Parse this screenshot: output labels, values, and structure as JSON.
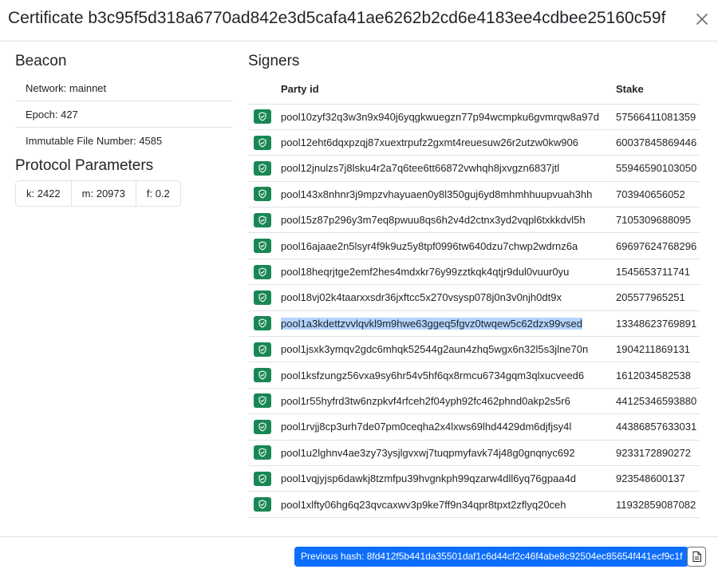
{
  "modal": {
    "title": "Certificate b3c95f5d318a6770ad842e3d5cafa41ae6262b2cd6e4183ee4cdbee25160c59f",
    "close_icon": "close-icon"
  },
  "beacon": {
    "title": "Beacon",
    "network": "Network: mainnet",
    "epoch": "Epoch: 427",
    "immutable_file_number": "Immutable File Number: 4585"
  },
  "protocol": {
    "title": "Protocol Parameters",
    "k": "k: 2422",
    "m": "m: 20973",
    "f": "f: 0.2"
  },
  "signers": {
    "title": "Signers",
    "columns": {
      "party_id": "Party id",
      "stake": "Stake"
    },
    "badge_icon": "shield-check-icon",
    "badge_color": "#198754",
    "rows": [
      {
        "party_id": "pool10zyf32q3w3n9x940j6yqgkwuegzn77p94wcmpku6gvmrqw8a97d",
        "stake": "57566411081359"
      },
      {
        "party_id": "pool12eht6dqxpzqj87xuextrpufz2gxmt4reuesuw26r2utzw0kw906",
        "stake": "60037845869446"
      },
      {
        "party_id": "pool12jnulzs7j8lsku4r2a7q6tee6tt66872vwhqh8jxvgzn6837jtl",
        "stake": "55946590103050"
      },
      {
        "party_id": "pool143x8nhnr3j9mpzvhayuaen0y8l350guj6yd8mhmhhuupvuah3hh",
        "stake": "703940656052"
      },
      {
        "party_id": "pool15z87p296y3m7eq8pwuu8qs6h2v4d2ctnx3yd2vqpl6txkkdvl5h",
        "stake": "7105309688095"
      },
      {
        "party_id": "pool16ajaae2n5lsyr4f9k9uz5y8tpf0996tw640dzu7chwp2wdrnz6a",
        "stake": "69697624768296"
      },
      {
        "party_id": "pool18heqrjtge2emf2hes4mdxkr76y99zztkqk4qtjr9dul0vuur0yu",
        "stake": "1545653711741"
      },
      {
        "party_id": "pool18vj02k4taarxxsdr36jxftcc5x270vsysp078j0n3v0njh0dt9x",
        "stake": "205577965251"
      },
      {
        "party_id": "pool1a3kdettzvvlqvkl9m9hwe63ggeq5fgvz0twqew5c62dzx99vsed",
        "stake": "13348623769891"
      },
      {
        "party_id": "pool1jsxk3ymqv2gdc6mhqk52544g2aun4zhq5wgx6n32l5s3jlne70n",
        "stake": "1904211869131"
      },
      {
        "party_id": "pool1ksfzungz56vxa9sy6hr54v5hf6qx8rmcu6734gqm3qlxucveed6",
        "stake": "1612034582538"
      },
      {
        "party_id": "pool1r55hyfrd3tw6nzpkvf4rfceh2f04yph92fc462phnd0akp2s5r6",
        "stake": "44125346593880"
      },
      {
        "party_id": "pool1rvjj8cp3urh7de07pm0ceqha2x4lxws69lhd4429dm6djfjsy4l",
        "stake": "44386857633031"
      },
      {
        "party_id": "pool1u2lghnv4ae3zy73ysjlgvxwj7tuqpmyfavk74j48g0gnqnyc692",
        "stake": "9233172890272"
      },
      {
        "party_id": "pool1vqjyjsp6dawkj8tzmfpu39hvgnkph99qzarw4dll6yq76gpaa4d",
        "stake": "923548600137"
      },
      {
        "party_id": "pool1xlfty06hg6q23qvcaxwv3p9ke7ff9n34qpr8tpxt2zflyq20ceh",
        "stake": "11932859087082"
      }
    ]
  },
  "footer": {
    "previous_hash_label": "Previous hash: 8fd412f5b441da35501daf1c6d44cf2c46f4abe8c92504ec85654f441ecf9c1f",
    "previous_hash_color": "#0d6efd",
    "download_icon": "file-icon"
  }
}
